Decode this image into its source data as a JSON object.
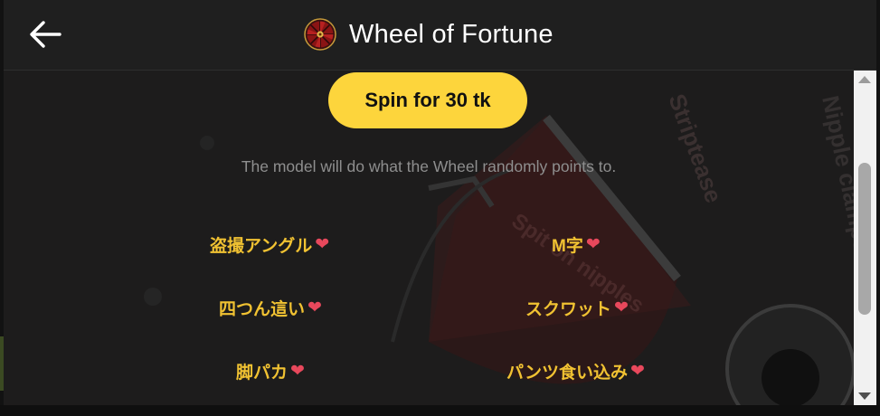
{
  "header": {
    "title": "Wheel of Fortune",
    "back_icon": "arrow-left-icon",
    "logo_icon": "wheel-icon"
  },
  "main": {
    "spin_button_label": "Spin for 30 tk",
    "description": "The model will do what the Wheel randomly points to.",
    "items": [
      {
        "label": "盗撮アングル",
        "heart": "❤"
      },
      {
        "label": "M字",
        "heart": "❤"
      },
      {
        "label": "四つん這い",
        "heart": "❤"
      },
      {
        "label": "スクワット",
        "heart": "❤"
      },
      {
        "label": "脚パカ",
        "heart": "❤"
      },
      {
        "label": "パンツ食い込み",
        "heart": "❤"
      }
    ],
    "background_wheel_labels": [
      "Striptease",
      "Nipple clamps",
      "Spit on nipples"
    ]
  },
  "colors": {
    "accent": "#fdd53c",
    "item_text": "#f1c232",
    "heart": "#e8485c",
    "background": "#1d1c1c",
    "header_bg": "#1f1f1f"
  }
}
